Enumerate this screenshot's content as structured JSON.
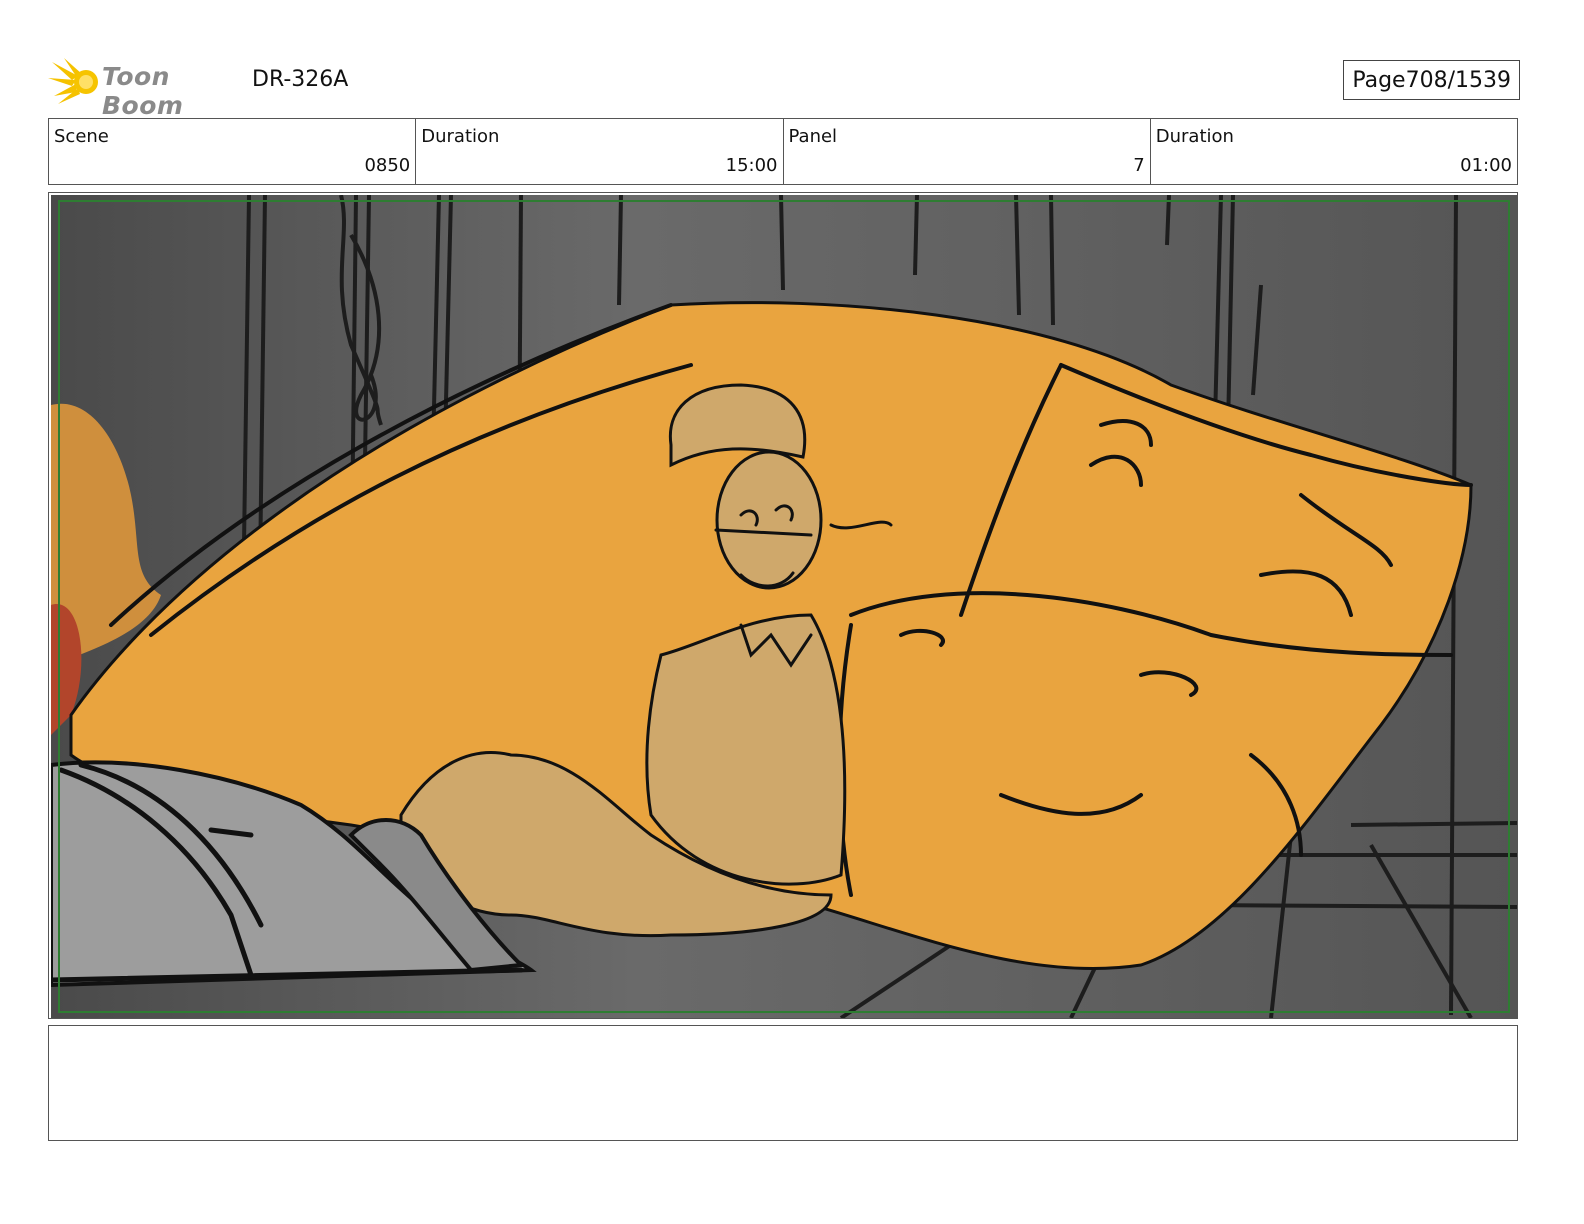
{
  "header": {
    "logo_text": "Toon Boom",
    "project_code": "DR-326A",
    "page_label": "Page",
    "page_value": "708/1539"
  },
  "info": [
    {
      "label": "Scene",
      "value": "0850"
    },
    {
      "label": "Duration",
      "value": "15:00"
    },
    {
      "label": "Panel",
      "value": "7"
    },
    {
      "label": "Duration",
      "value": "01:00"
    }
  ],
  "panel": {
    "colors": {
      "background": "#5c5c5c",
      "orange": "#e9a43f",
      "character": "#cfa86b",
      "metal": "#9d9d9d",
      "safe_frame": "#2e7d32"
    }
  },
  "notes": {
    "text": ""
  }
}
